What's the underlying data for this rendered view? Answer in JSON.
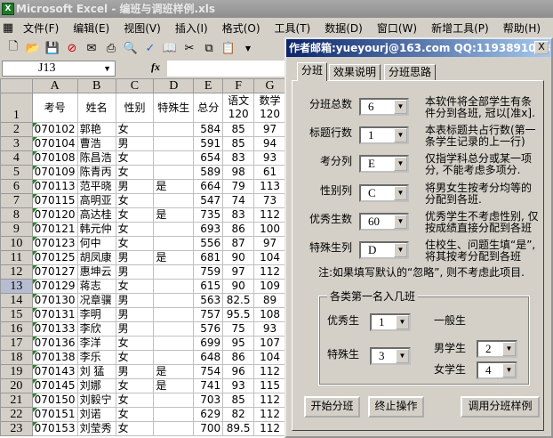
{
  "window": {
    "title": "Microsoft Excel - 编班与调班样例.xls"
  },
  "menu": [
    "文件(F)",
    "编辑(E)",
    "视图(V)",
    "插入(I)",
    "格式(O)",
    "工具(T)",
    "数据(D)",
    "窗口(W)",
    "新增工具(P)",
    "帮助(H)"
  ],
  "formula": {
    "name_box": "J13",
    "fx": "fx",
    "value": ""
  },
  "columns": [
    "A",
    "B",
    "C",
    "D",
    "E",
    "F",
    "G"
  ],
  "header_row": {
    "num": "1",
    "cells": [
      "考号",
      "姓名",
      "性别",
      "特殊生",
      "总分",
      "语文 120",
      "数学 120"
    ]
  },
  "rows": [
    [
      "2",
      "070102",
      "郭艳",
      "女",
      "",
      "584",
      "85",
      "97"
    ],
    [
      "3",
      "070104",
      "曹浩",
      "男",
      "",
      "591",
      "85",
      "94"
    ],
    [
      "4",
      "070108",
      "陈昌浩",
      "女",
      "",
      "654",
      "83",
      "93"
    ],
    [
      "5",
      "070109",
      "陈青丙",
      "女",
      "",
      "589",
      "98",
      "61"
    ],
    [
      "6",
      "070113",
      "范平晓",
      "男",
      "是",
      "664",
      "79",
      "113"
    ],
    [
      "7",
      "070115",
      "高明亚",
      "女",
      "",
      "547",
      "74",
      "73"
    ],
    [
      "8",
      "070120",
      "高达桂",
      "女",
      "是",
      "735",
      "83",
      "112"
    ],
    [
      "9",
      "070121",
      "韩元仲",
      "女",
      "",
      "693",
      "86",
      "100"
    ],
    [
      "10",
      "070123",
      "何中",
      "女",
      "",
      "556",
      "87",
      "97"
    ],
    [
      "11",
      "070125",
      "胡凤康",
      "男",
      "是",
      "681",
      "90",
      "104"
    ],
    [
      "12",
      "070127",
      "惠坤云",
      "男",
      "",
      "759",
      "97",
      "112"
    ],
    [
      "13",
      "070129",
      "蒋志",
      "女",
      "",
      "615",
      "90",
      "109"
    ],
    [
      "14",
      "070130",
      "况章骥",
      "男",
      "",
      "563",
      "82.5",
      "89"
    ],
    [
      "15",
      "070131",
      "李明",
      "男",
      "",
      "757",
      "95.5",
      "108"
    ],
    [
      "16",
      "070133",
      "李欣",
      "男",
      "",
      "576",
      "75",
      "93"
    ],
    [
      "17",
      "070136",
      "李洋",
      "女",
      "",
      "699",
      "95",
      "107"
    ],
    [
      "18",
      "070138",
      "李乐",
      "女",
      "",
      "648",
      "86",
      "104"
    ],
    [
      "19",
      "070143",
      "刘 猛",
      "男",
      "是",
      "754",
      "96",
      "112"
    ],
    [
      "20",
      "070145",
      "刘娜",
      "女",
      "是",
      "741",
      "93",
      "115"
    ],
    [
      "21",
      "070150",
      "刘毅宁",
      "女",
      "",
      "703",
      "85",
      "112"
    ],
    [
      "22",
      "070151",
      "刘诺",
      "女",
      "",
      "629",
      "82",
      "112"
    ],
    [
      "23",
      "070153",
      "刘莹秀",
      "女",
      "",
      "700",
      "89.5",
      "112"
    ]
  ],
  "dialog": {
    "title": "作者邮箱:yueyourj@163.com QQ:1193891098",
    "close": "X",
    "tabs": [
      "分班",
      "效果说明",
      "分班思路"
    ],
    "settings": [
      {
        "label": "分班总数",
        "value": "6",
        "desc": "本软件将全部学生有条件分到各班, 冠以[准x]."
      },
      {
        "label": "标题行数",
        "value": "1",
        "desc": "本表标题共占行数(第一条学生记录的上一行)"
      },
      {
        "label": "考分列",
        "value": "E",
        "desc": "仅指学科总分或某一项分, 不能考虑多项分."
      },
      {
        "label": "性别列",
        "value": "C",
        "desc": "将男女生按考分均等的分配到各班."
      },
      {
        "label": "优秀生数",
        "value": "60",
        "desc": "优秀学生不考虑性别, 仅按成绩直接分配到各班"
      },
      {
        "label": "特殊生列",
        "value": "D",
        "desc": "住校生、问题生填“是”, 将其按考分配到各班"
      }
    ],
    "note": "注:如果填写默认的“忽略”, 则不考虑此项目.",
    "group": {
      "title": "各类第一名入几班",
      "excellent_label": "优秀生",
      "excellent": "1",
      "special_label": "特殊生",
      "special": "3",
      "general_label": "一般生",
      "male_label": "男学生",
      "male": "2",
      "female_label": "女学生",
      "female": "4"
    },
    "buttons": {
      "start": "开始分班",
      "stop": "终止操作",
      "sample": "调用分班样例"
    }
  }
}
